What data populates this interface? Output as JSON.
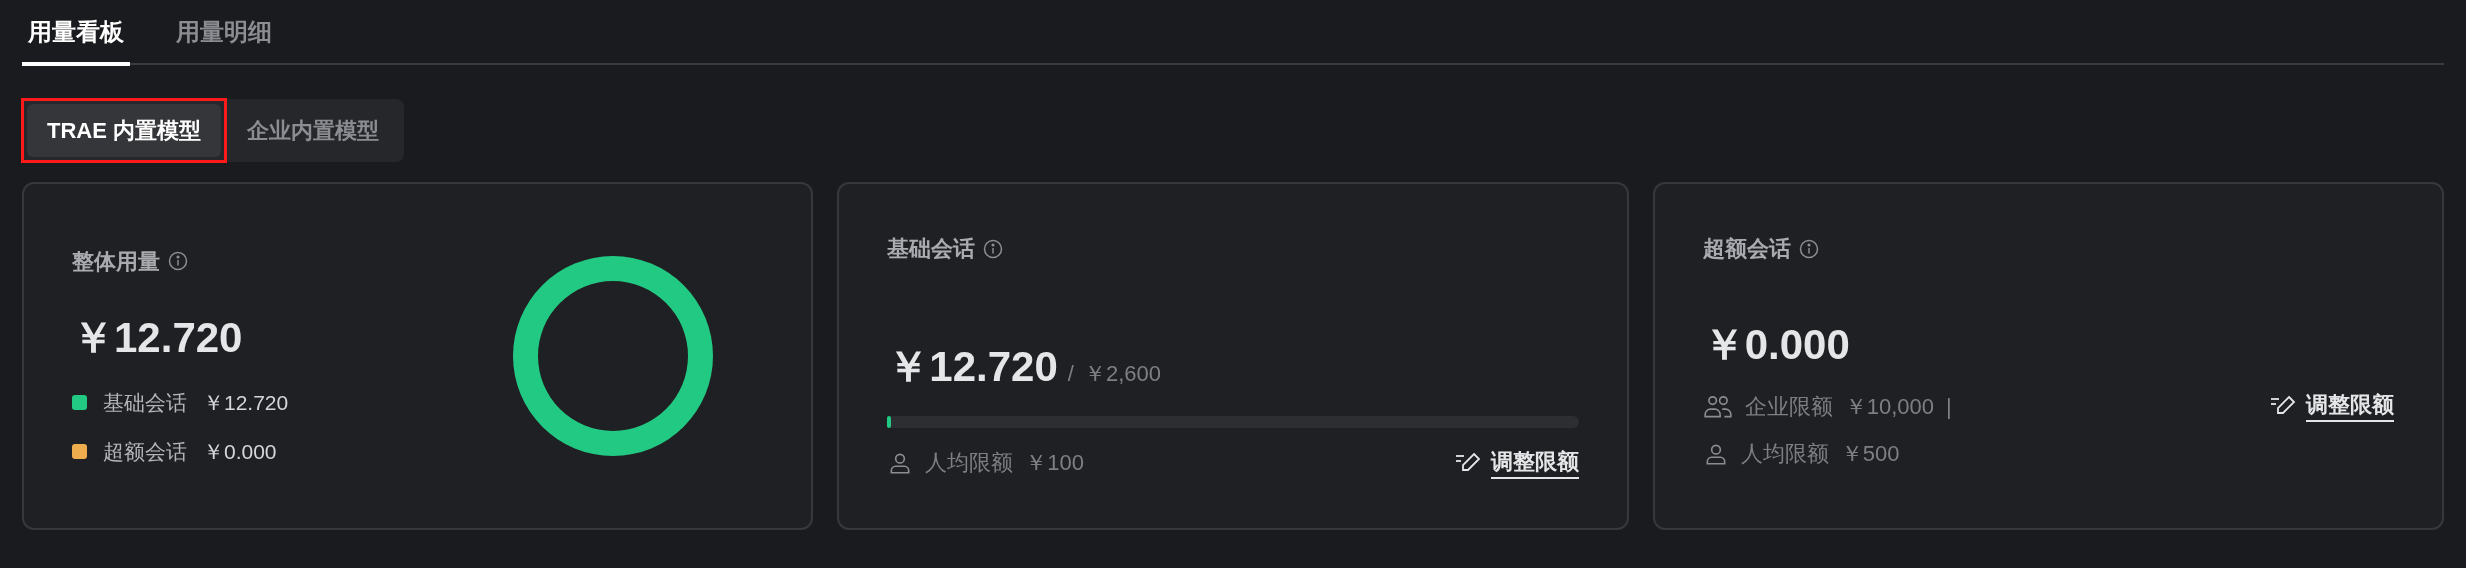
{
  "tabs": [
    {
      "label": "用量看板",
      "selected": true
    },
    {
      "label": "用量明细",
      "selected": false
    }
  ],
  "segments": [
    {
      "label": "TRAE 内置模型",
      "selected": true,
      "highlighted": true
    },
    {
      "label": "企业内置模型",
      "selected": false,
      "highlighted": false
    }
  ],
  "overall": {
    "title": "整体用量",
    "amount": "￥12.720",
    "legend": [
      {
        "label": "基础会话",
        "value": "￥12.720",
        "color": "#22c983"
      },
      {
        "label": "超额会话",
        "value": "￥0.000",
        "color": "#f0ad4e"
      }
    ]
  },
  "basic": {
    "title": "基础会话",
    "amount": "￥12.720",
    "separator": "/",
    "limit": "￥2,600",
    "level": 0.005,
    "quotas": [
      {
        "kind": "person",
        "label": "人均限额",
        "value": "￥100"
      }
    ],
    "action": "调整限额"
  },
  "extra": {
    "title": "超额会话",
    "amount": "￥0.000",
    "quotas": [
      {
        "kind": "group",
        "label": "企业限额",
        "value": "￥10,000",
        "divider": "|"
      },
      {
        "kind": "person",
        "label": "人均限额",
        "value": "￥500"
      }
    ],
    "action": "调整限额"
  }
}
